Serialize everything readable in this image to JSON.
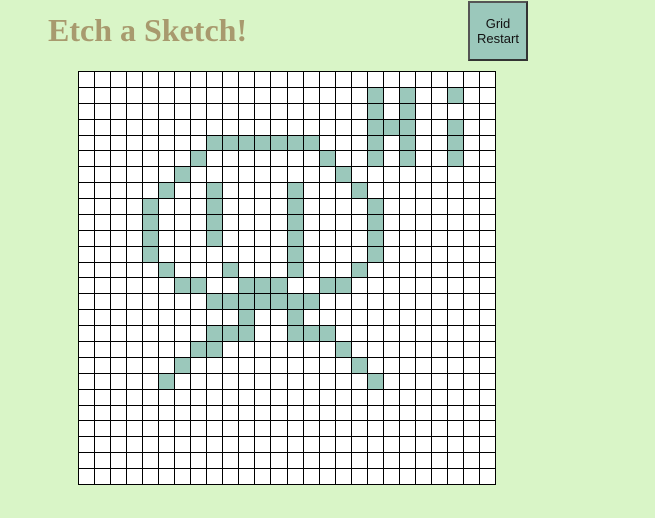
{
  "app": {
    "title": "Etch a Sketch!"
  },
  "controls": {
    "restart_label": "Grid\nRestart"
  },
  "grid": {
    "columns": 26,
    "rows": 26,
    "cell_color": "#ffffff",
    "filled_color": "#9bc8bb",
    "line_color": "#000000",
    "filled_cells": [
      [
        1,
        18
      ],
      [
        1,
        20
      ],
      [
        1,
        23
      ],
      [
        2,
        18
      ],
      [
        2,
        20
      ],
      [
        3,
        18
      ],
      [
        3,
        19
      ],
      [
        3,
        20
      ],
      [
        3,
        23
      ],
      [
        4,
        8
      ],
      [
        4,
        9
      ],
      [
        4,
        10
      ],
      [
        4,
        11
      ],
      [
        4,
        12
      ],
      [
        4,
        13
      ],
      [
        4,
        14
      ],
      [
        4,
        18
      ],
      [
        4,
        20
      ],
      [
        4,
        23
      ],
      [
        5,
        7
      ],
      [
        5,
        15
      ],
      [
        5,
        18
      ],
      [
        5,
        20
      ],
      [
        5,
        23
      ],
      [
        6,
        6
      ],
      [
        6,
        16
      ],
      [
        7,
        5
      ],
      [
        7,
        8
      ],
      [
        7,
        13
      ],
      [
        7,
        17
      ],
      [
        8,
        4
      ],
      [
        8,
        8
      ],
      [
        8,
        13
      ],
      [
        8,
        18
      ],
      [
        9,
        4
      ],
      [
        9,
        8
      ],
      [
        9,
        13
      ],
      [
        9,
        18
      ],
      [
        10,
        4
      ],
      [
        10,
        8
      ],
      [
        10,
        13
      ],
      [
        10,
        18
      ],
      [
        11,
        4
      ],
      [
        11,
        13
      ],
      [
        11,
        18
      ],
      [
        12,
        5
      ],
      [
        12,
        9
      ],
      [
        12,
        13
      ],
      [
        12,
        17
      ],
      [
        13,
        6
      ],
      [
        13,
        7
      ],
      [
        13,
        10
      ],
      [
        13,
        11
      ],
      [
        13,
        12
      ],
      [
        13,
        15
      ],
      [
        13,
        16
      ],
      [
        14,
        8
      ],
      [
        14,
        9
      ],
      [
        14,
        10
      ],
      [
        14,
        11
      ],
      [
        14,
        12
      ],
      [
        14,
        13
      ],
      [
        14,
        14
      ],
      [
        15,
        10
      ],
      [
        15,
        13
      ],
      [
        16,
        8
      ],
      [
        16,
        9
      ],
      [
        16,
        10
      ],
      [
        16,
        13
      ],
      [
        16,
        14
      ],
      [
        16,
        15
      ],
      [
        17,
        7
      ],
      [
        17,
        8
      ],
      [
        17,
        16
      ],
      [
        18,
        6
      ],
      [
        18,
        17
      ],
      [
        19,
        5
      ],
      [
        19,
        18
      ]
    ]
  }
}
